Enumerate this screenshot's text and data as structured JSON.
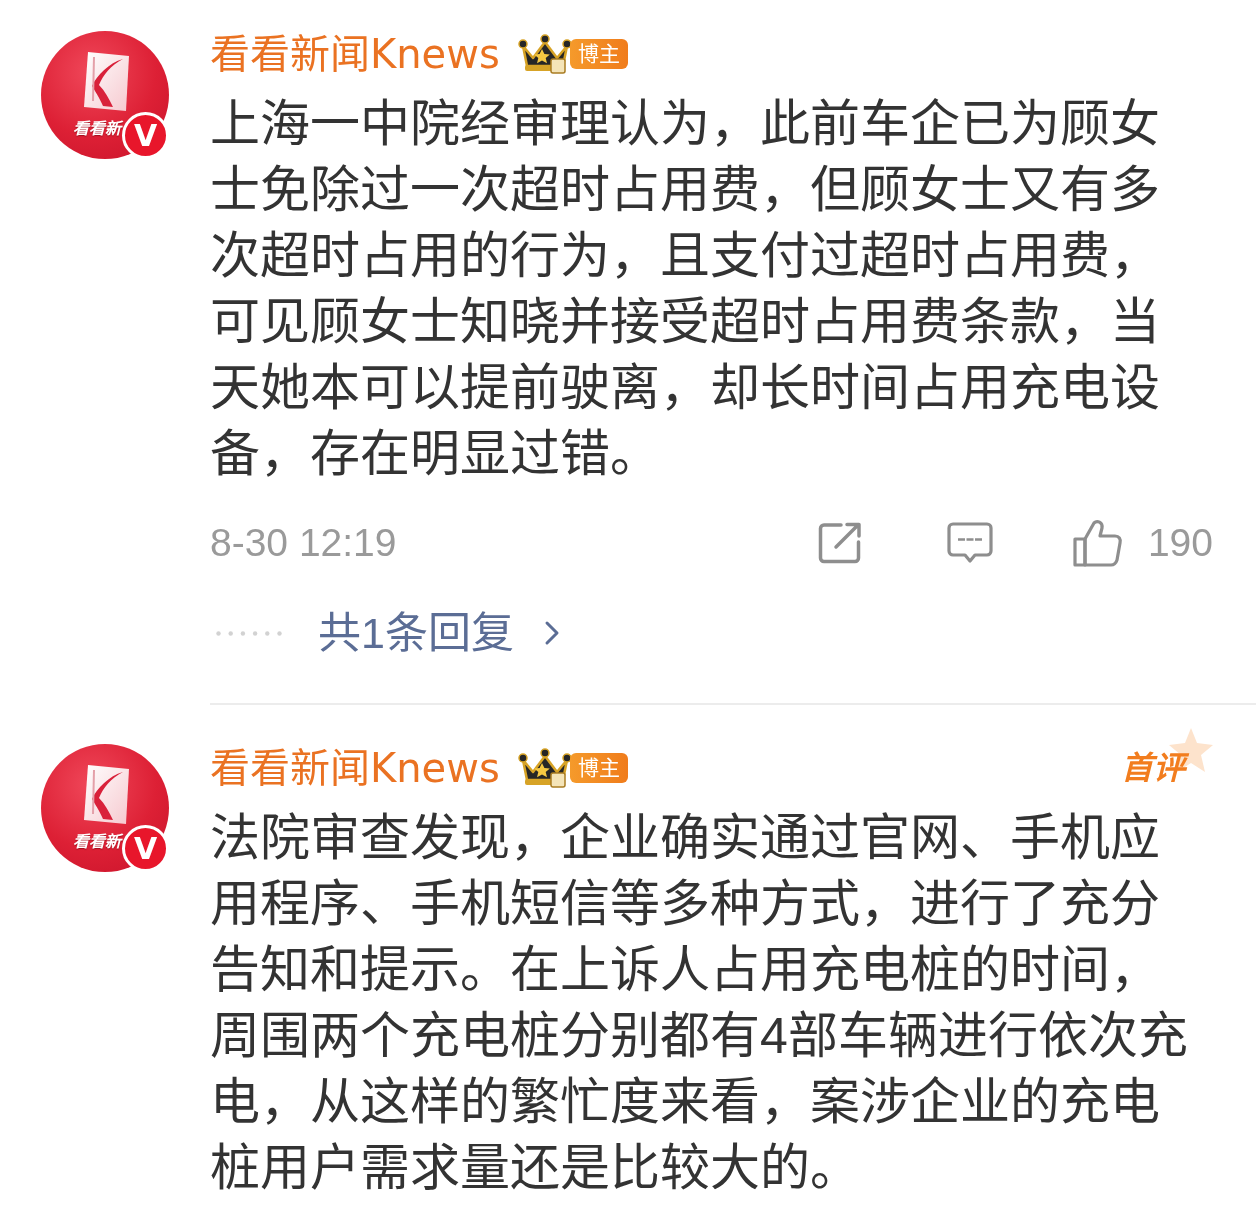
{
  "comments": [
    {
      "author": {
        "name": "看看新闻Knews",
        "avatar_text": "看看新",
        "verified_mark": "V",
        "role_badge": "博主"
      },
      "text": "上海一中院经审理认为，此前车企已为顾女士免除过一次超时占用费，但顾女士又有多次超时占用的行为，且支付过超时占用费，可见顾女士知晓并接受超时占用费条款，当天她本可以提前驶离，却长时间占用充电设备，存在明显过错。",
      "time": "8-30 12:19",
      "likes": "190",
      "replies": "共1条回复"
    },
    {
      "author": {
        "name": "看看新闻Knews",
        "avatar_text": "看看新",
        "verified_mark": "V",
        "role_badge": "博主"
      },
      "first_badge": "首评",
      "text": "法院审查发现，企业确实通过官网、手机应用程序、手机短信等多种方式，进行了充分告知和提示。在上诉人占用充电桩的时间，周围两个充电桩分别都有4部车辆进行依次充电，从这样的繁忙度来看，案涉企业的充电桩用户需求量还是比较大的。"
    }
  ]
}
